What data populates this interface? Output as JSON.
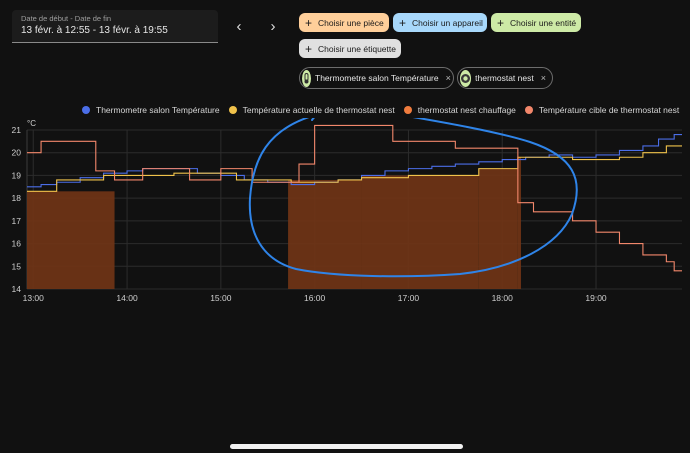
{
  "date_picker": {
    "label": "Date de début - Date de fin",
    "value": "13 févr. à 12:55 - 13 févr. à 19:55"
  },
  "nav": {
    "prev_icon": "chevron-left-icon",
    "next_icon": "chevron-right-icon",
    "prev": "‹",
    "next": "›"
  },
  "target_chips": {
    "area": "Choisir une pièce",
    "device": "Choisir un appareil",
    "entity": "Choisir une entité",
    "label": "Choisir une étiquette",
    "plus": "+"
  },
  "selected": [
    {
      "label": "Thermometre salon Température",
      "icon": "thermometer-icon",
      "remove": "×"
    },
    {
      "label": "thermostat nest",
      "icon": "thermostat-icon",
      "remove": "×"
    }
  ],
  "colors": {
    "series_blue": "#4b6ee8",
    "series_yellow": "#f0c24b",
    "series_orange": "#f07c3e",
    "series_salmon": "#f2876b",
    "heating_fill": "#6e3416",
    "annotation": "#2f84e8"
  },
  "chart_data": {
    "type": "line",
    "ylabel": "°C",
    "ylim": [
      14,
      21
    ],
    "yticks": [
      14,
      15,
      16,
      17,
      18,
      19,
      20,
      21
    ],
    "xlim": [
      "12:56",
      "19:55"
    ],
    "xticks": [
      "13:00",
      "14:00",
      "15:00",
      "16:00",
      "17:00",
      "18:00",
      "19:00"
    ],
    "grid": true,
    "legend": "top",
    "series": [
      {
        "name": "Thermometre salon Température",
        "color": "#4b6ee8",
        "step": true,
        "points": [
          [
            "12:56",
            18.5
          ],
          [
            "13:05",
            18.6
          ],
          [
            "13:15",
            18.7
          ],
          [
            "13:30",
            18.9
          ],
          [
            "13:45",
            19.1
          ],
          [
            "14:00",
            19.2
          ],
          [
            "14:10",
            19.3
          ],
          [
            "14:30",
            19.3
          ],
          [
            "14:45",
            19.1
          ],
          [
            "15:00",
            19.0
          ],
          [
            "15:15",
            18.8
          ],
          [
            "15:30",
            18.7
          ],
          [
            "15:45",
            18.6
          ],
          [
            "16:00",
            18.7
          ],
          [
            "16:15",
            18.8
          ],
          [
            "16:30",
            19.0
          ],
          [
            "16:45",
            19.2
          ],
          [
            "17:00",
            19.3
          ],
          [
            "17:15",
            19.4
          ],
          [
            "17:30",
            19.5
          ],
          [
            "17:45",
            19.6
          ],
          [
            "18:00",
            19.7
          ],
          [
            "18:15",
            19.8
          ],
          [
            "18:30",
            19.9
          ],
          [
            "18:45",
            19.8
          ],
          [
            "19:00",
            19.9
          ],
          [
            "19:15",
            20.1
          ],
          [
            "19:30",
            20.3
          ],
          [
            "19:40",
            20.6
          ],
          [
            "19:50",
            20.8
          ],
          [
            "19:55",
            20.8
          ]
        ]
      },
      {
        "name": "Température actuelle de thermostat nest",
        "color": "#f0c24b",
        "step": true,
        "points": [
          [
            "12:56",
            18.3
          ],
          [
            "13:15",
            18.8
          ],
          [
            "13:45",
            19.0
          ],
          [
            "14:30",
            19.1
          ],
          [
            "15:00",
            19.1
          ],
          [
            "15:10",
            18.8
          ],
          [
            "15:45",
            18.7
          ],
          [
            "16:15",
            18.8
          ],
          [
            "16:30",
            18.9
          ],
          [
            "17:00",
            19.0
          ],
          [
            "17:45",
            19.3
          ],
          [
            "18:10",
            19.8
          ],
          [
            "18:45",
            19.7
          ],
          [
            "19:15",
            19.8
          ],
          [
            "19:30",
            20.0
          ],
          [
            "19:45",
            20.3
          ],
          [
            "19:55",
            20.3
          ]
        ]
      },
      {
        "name": "thermostat nest chauffage",
        "color": "#f07c3e",
        "type": "area",
        "ranges": [
          [
            "12:56",
            "13:52",
            18.3
          ],
          [
            "15:43",
            "16:30",
            18.8
          ],
          [
            "16:30",
            "17:45",
            19.0
          ],
          [
            "17:45",
            "18:10",
            19.3
          ],
          [
            "18:10",
            "18:12",
            19.8
          ]
        ]
      },
      {
        "name": "Température cible de thermostat nest",
        "color": "#f2876b",
        "step": true,
        "points": [
          [
            "12:56",
            20.0
          ],
          [
            "13:05",
            20.5
          ],
          [
            "13:40",
            19.2
          ],
          [
            "13:52",
            18.8
          ],
          [
            "14:10",
            19.3
          ],
          [
            "14:40",
            18.8
          ],
          [
            "15:00",
            19.3
          ],
          [
            "15:20",
            18.7
          ],
          [
            "15:50",
            19.5
          ],
          [
            "16:00",
            21.2
          ],
          [
            "16:50",
            20.5
          ],
          [
            "17:30",
            20.2
          ],
          [
            "18:10",
            17.8
          ],
          [
            "18:20",
            17.4
          ],
          [
            "18:45",
            17.0
          ],
          [
            "19:00",
            16.5
          ],
          [
            "19:15",
            16.0
          ],
          [
            "19:30",
            15.5
          ],
          [
            "19:45",
            15.2
          ],
          [
            "19:50",
            14.8
          ],
          [
            "19:55",
            14.8
          ]
        ]
      }
    ]
  }
}
